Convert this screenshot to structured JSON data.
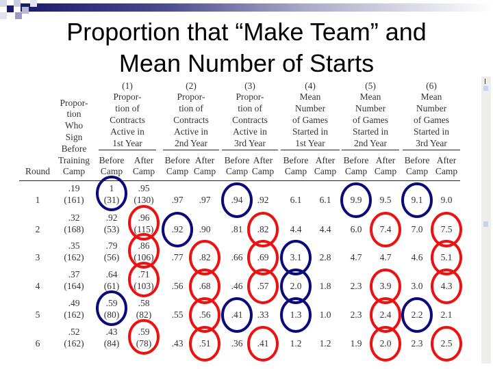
{
  "slide": {
    "title_line1": "Proportion that “Make Team” and",
    "title_line2": "Mean Number of Starts",
    "accent_dark": "#1a1a6e",
    "circle_red": "#ee1111",
    "circle_blue": "#0a0a7a"
  },
  "table": {
    "col0_header": "Round",
    "col1_header": [
      "Propor-",
      "tion",
      "Who",
      "Sign",
      "Before",
      "Training",
      "Camp"
    ],
    "groups": [
      {
        "num": "(1)",
        "lines": [
          "Propor-",
          "tion of",
          "Contracts",
          "Active in",
          "1st Year"
        ]
      },
      {
        "num": "(2)",
        "lines": [
          "Propor-",
          "tion of",
          "Contracts",
          "Active in",
          "2nd Year"
        ]
      },
      {
        "num": "(3)",
        "lines": [
          "Propor-",
          "tion of",
          "Contracts",
          "Active in",
          "3rd Year"
        ]
      },
      {
        "num": "(4)",
        "lines": [
          "Mean",
          "Number",
          "of Games",
          "Started in",
          "1st Year"
        ]
      },
      {
        "num": "(5)",
        "lines": [
          "Mean",
          "Number",
          "of Games",
          "Started in",
          "2nd Year"
        ]
      },
      {
        "num": "(6)",
        "lines": [
          "Mean",
          "Number",
          "of Games",
          "Started in",
          "3rd Year"
        ]
      }
    ],
    "sub_before": [
      "Before",
      "Camp"
    ],
    "sub_after": [
      "After",
      "Camp"
    ],
    "rows": [
      {
        "round": "1",
        "sign": ".19",
        "sign_n": "(161)",
        "c1b": "1",
        "c1b_n": "(31)",
        "c1a": ".95",
        "c1a_n": "(130)",
        "c2b": ".97",
        "c2a": ".97",
        "c3b": ".94",
        "c3a": ".92",
        "c4b": "6.1",
        "c4a": "6.1",
        "c5b": "9.9",
        "c5a": "9.5",
        "c6b": "9.1",
        "c6a": "9.0"
      },
      {
        "round": "2",
        "sign": ".32",
        "sign_n": "(168)",
        "c1b": ".92",
        "c1b_n": "(53)",
        "c1a": ".96",
        "c1a_n": "(115)",
        "c2b": ".92",
        "c2a": ".90",
        "c3b": ".81",
        "c3a": ".82",
        "c4b": "4.4",
        "c4a": "4.4",
        "c5b": "6.0",
        "c5a": "7.4",
        "c6b": "7.0",
        "c6a": "7.5"
      },
      {
        "round": "3",
        "sign": ".35",
        "sign_n": "(162)",
        "c1b": ".79",
        "c1b_n": "(56)",
        "c1a": ".86",
        "c1a_n": "(106)",
        "c2b": ".77",
        "c2a": ".82",
        "c3b": ".66",
        "c3a": ".69",
        "c4b": "3.1",
        "c4a": "2.8",
        "c5b": "4.7",
        "c5a": "4.7",
        "c6b": "4.6",
        "c6a": "5.1"
      },
      {
        "round": "4",
        "sign": ".37",
        "sign_n": "(164)",
        "c1b": ".64",
        "c1b_n": "(61)",
        "c1a": ".71",
        "c1a_n": "(103)",
        "c2b": ".56",
        "c2a": ".68",
        "c3b": ".46",
        "c3a": ".57",
        "c4b": "2.0",
        "c4a": "1.8",
        "c5b": "2.3",
        "c5a": "3.9",
        "c6b": "3.0",
        "c6a": "4.3"
      },
      {
        "round": "5",
        "sign": ".49",
        "sign_n": "(162)",
        "c1b": ".59",
        "c1b_n": "(80)",
        "c1a": ".58",
        "c1a_n": "(82)",
        "c2b": ".55",
        "c2a": ".56",
        "c3b": ".41",
        "c3a": ".33",
        "c4b": "1.3",
        "c4a": "1.0",
        "c5b": "2.3",
        "c5a": "2.4",
        "c6b": "2.2",
        "c6a": "2.1"
      },
      {
        "round": "6",
        "sign": ".52",
        "sign_n": "(162)",
        "c1b": ".43",
        "c1b_n": "(84)",
        "c1a": ".59",
        "c1a_n": "(78)",
        "c2b": ".43",
        "c2a": ".51",
        "c3b": ".36",
        "c3a": ".41",
        "c4b": "1.2",
        "c4a": "1.2",
        "c5b": "1.9",
        "c5a": "2.0",
        "c6b": "2.3",
        "c6a": "2.5"
      }
    ],
    "circles": [
      {
        "row": 0,
        "col": "c1b",
        "color": "blue"
      },
      {
        "row": 0,
        "col": "c3b",
        "color": "blue"
      },
      {
        "row": 0,
        "col": "c5b",
        "color": "blue"
      },
      {
        "row": 0,
        "col": "c6b",
        "color": "blue"
      },
      {
        "row": 1,
        "col": "c1a",
        "color": "red"
      },
      {
        "row": 1,
        "col": "c2b",
        "color": "blue"
      },
      {
        "row": 1,
        "col": "c3a",
        "color": "red"
      },
      {
        "row": 1,
        "col": "c5a",
        "color": "red"
      },
      {
        "row": 1,
        "col": "c6a",
        "color": "red"
      },
      {
        "row": 2,
        "col": "c1a",
        "color": "red"
      },
      {
        "row": 2,
        "col": "c2a",
        "color": "red"
      },
      {
        "row": 2,
        "col": "c3a",
        "color": "red"
      },
      {
        "row": 2,
        "col": "c4b",
        "color": "blue"
      },
      {
        "row": 2,
        "col": "c6a",
        "color": "red"
      },
      {
        "row": 3,
        "col": "c1a",
        "color": "red"
      },
      {
        "row": 3,
        "col": "c2a",
        "color": "red"
      },
      {
        "row": 3,
        "col": "c3a",
        "color": "red"
      },
      {
        "row": 3,
        "col": "c4b",
        "color": "blue"
      },
      {
        "row": 3,
        "col": "c5a",
        "color": "red"
      },
      {
        "row": 3,
        "col": "c6a",
        "color": "red"
      },
      {
        "row": 4,
        "col": "c1b",
        "color": "blue"
      },
      {
        "row": 4,
        "col": "c2a",
        "color": "red"
      },
      {
        "row": 4,
        "col": "c3b",
        "color": "blue"
      },
      {
        "row": 4,
        "col": "c4b",
        "color": "blue"
      },
      {
        "row": 4,
        "col": "c5a",
        "color": "red"
      },
      {
        "row": 4,
        "col": "c6b",
        "color": "blue"
      },
      {
        "row": 5,
        "col": "c1a",
        "color": "red"
      },
      {
        "row": 5,
        "col": "c2a",
        "color": "red"
      },
      {
        "row": 5,
        "col": "c3a",
        "color": "red"
      },
      {
        "row": 5,
        "col": "c5a",
        "color": "red"
      },
      {
        "row": 5,
        "col": "c6a",
        "color": "red"
      }
    ]
  }
}
